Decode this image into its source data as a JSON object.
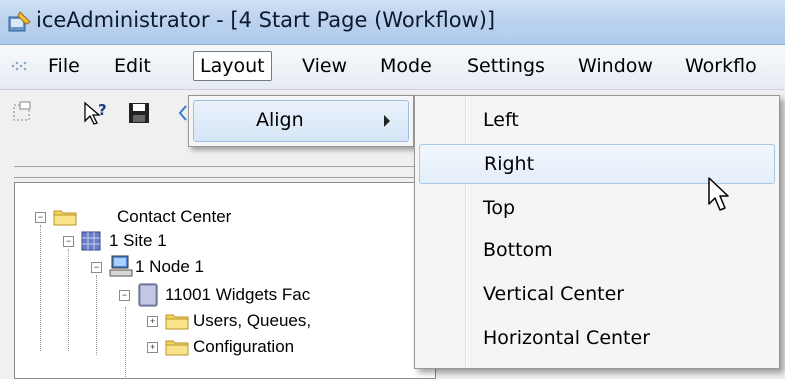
{
  "window": {
    "title": "iceAdministrator - [4 Start Page (Workflow)]"
  },
  "menubar": {
    "items": [
      {
        "label": "File"
      },
      {
        "label": "Edit"
      },
      {
        "label": "Layout",
        "active": true
      },
      {
        "label": "View"
      },
      {
        "label": "Mode"
      },
      {
        "label": "Settings"
      },
      {
        "label": "Window"
      },
      {
        "label": "Workflo"
      }
    ]
  },
  "toolbar": {
    "icons": [
      "new-node-icon",
      "help-icon",
      "save-icon"
    ]
  },
  "layout_menu": {
    "items": [
      {
        "label": "Align",
        "has_submenu": true
      }
    ]
  },
  "align_menu": {
    "items": [
      {
        "label": "Left"
      },
      {
        "label": "Right",
        "highlighted": true
      },
      {
        "label": "Top"
      },
      {
        "label": "Bottom"
      },
      {
        "label": "Vertical Center"
      },
      {
        "label": "Horizontal Center"
      }
    ]
  },
  "tree": {
    "nodes": [
      {
        "label": "Contact Center",
        "icon": "folder-icon"
      },
      {
        "label": "1 Site 1",
        "icon": "site-icon"
      },
      {
        "label": "1 Node 1",
        "icon": "computer-icon"
      },
      {
        "label": "11001 Widgets Fac",
        "icon": "server-icon"
      },
      {
        "label": "Users, Queues,",
        "icon": "folder-icon"
      },
      {
        "label": "Configuration",
        "icon": "folder-icon"
      }
    ]
  },
  "colors": {
    "titlebar": "#bcd3ef",
    "menu_highlight_border": "#a8c8ea",
    "folder": "#f2d463"
  }
}
